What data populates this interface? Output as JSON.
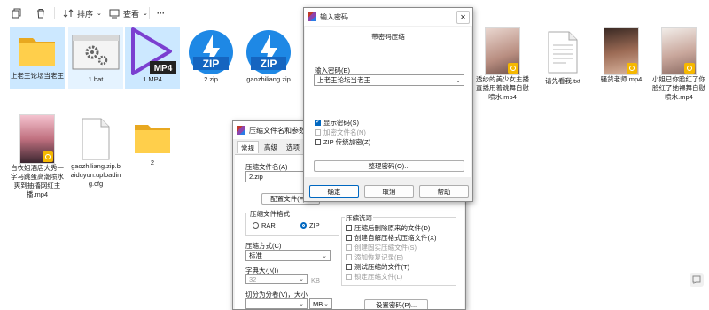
{
  "toolbar": {
    "sort_label": "排序",
    "view_label": "查看",
    "more_label": "···"
  },
  "files": [
    {
      "name": "上老王论坛当老王",
      "type": "folder"
    },
    {
      "name": "1.bat",
      "type": "bat"
    },
    {
      "name": "1.MP4",
      "type": "mp4",
      "badge": "MP4"
    },
    {
      "name": "2.zip",
      "type": "zip",
      "badge": "ZIP"
    },
    {
      "name": "gaozhiliang.zip",
      "type": "zip",
      "badge": "ZIP"
    },
    {
      "name": "透纱的美少女主播直播用着跳舞自慰喷水.mp4",
      "type": "video"
    },
    {
      "name": "请先看我.txt",
      "type": "txt"
    },
    {
      "name": "骚货老师.mp4",
      "type": "video"
    },
    {
      "name": "小姐已你脸红了你脸红了她裸舞自慰喷水.mp4",
      "type": "video"
    },
    {
      "name": "白衣姐酒店大秀一字马跳蛋高潮喷水爽到抽搐网红主播.mp4",
      "type": "video"
    },
    {
      "name": "gaozhiliang.zip.baiduyun.uploading.cfg",
      "type": "cfg"
    },
    {
      "name": "2",
      "type": "folder"
    }
  ],
  "compress_dialog": {
    "title": "压缩文件名和参数",
    "tabs": [
      "常规",
      "高级",
      "选项"
    ],
    "archive_name_label": "压缩文件名(A)",
    "archive_name_value": "2.zip",
    "profiles_button": "配置文件(F)...",
    "format_label": "压缩文件格式",
    "format_rar": "RAR",
    "format_zip": "ZIP",
    "method_label": "压缩方式(C)",
    "method_value": "标准",
    "dict_label": "字典大小(I)",
    "dict_value": "32",
    "dict_unit": "KB",
    "split_label": "切分为分卷(V)，大小",
    "split_unit": "MB",
    "options_label": "压缩选项",
    "options": [
      {
        "label": "压缩后删除原来的文件(D)",
        "checked": false,
        "disabled": false
      },
      {
        "label": "创建自解压格式压缩文件(X)",
        "checked": false,
        "disabled": false
      },
      {
        "label": "创建固实压缩文件(S)",
        "checked": false,
        "disabled": true
      },
      {
        "label": "添加恢复记录(E)",
        "checked": false,
        "disabled": true
      },
      {
        "label": "测试压缩的文件(T)",
        "checked": false,
        "disabled": false
      },
      {
        "label": "锁定压缩文件(L)",
        "checked": false,
        "disabled": true
      }
    ],
    "set_password_button": "设置密码(P)..."
  },
  "password_dialog": {
    "title": "输入密码",
    "heading": "带密码压缩",
    "enter_label": "输入密码(E)",
    "password_value": "上老王论坛当老王",
    "show_password": "显示密码(S)",
    "encrypt_names": "加密文件名(N)",
    "zip_legacy": "ZIP 传统加密(Z)",
    "organize_button": "整理密码(O)...",
    "ok_button": "确定",
    "cancel_button": "取消",
    "help_button": "帮助"
  }
}
